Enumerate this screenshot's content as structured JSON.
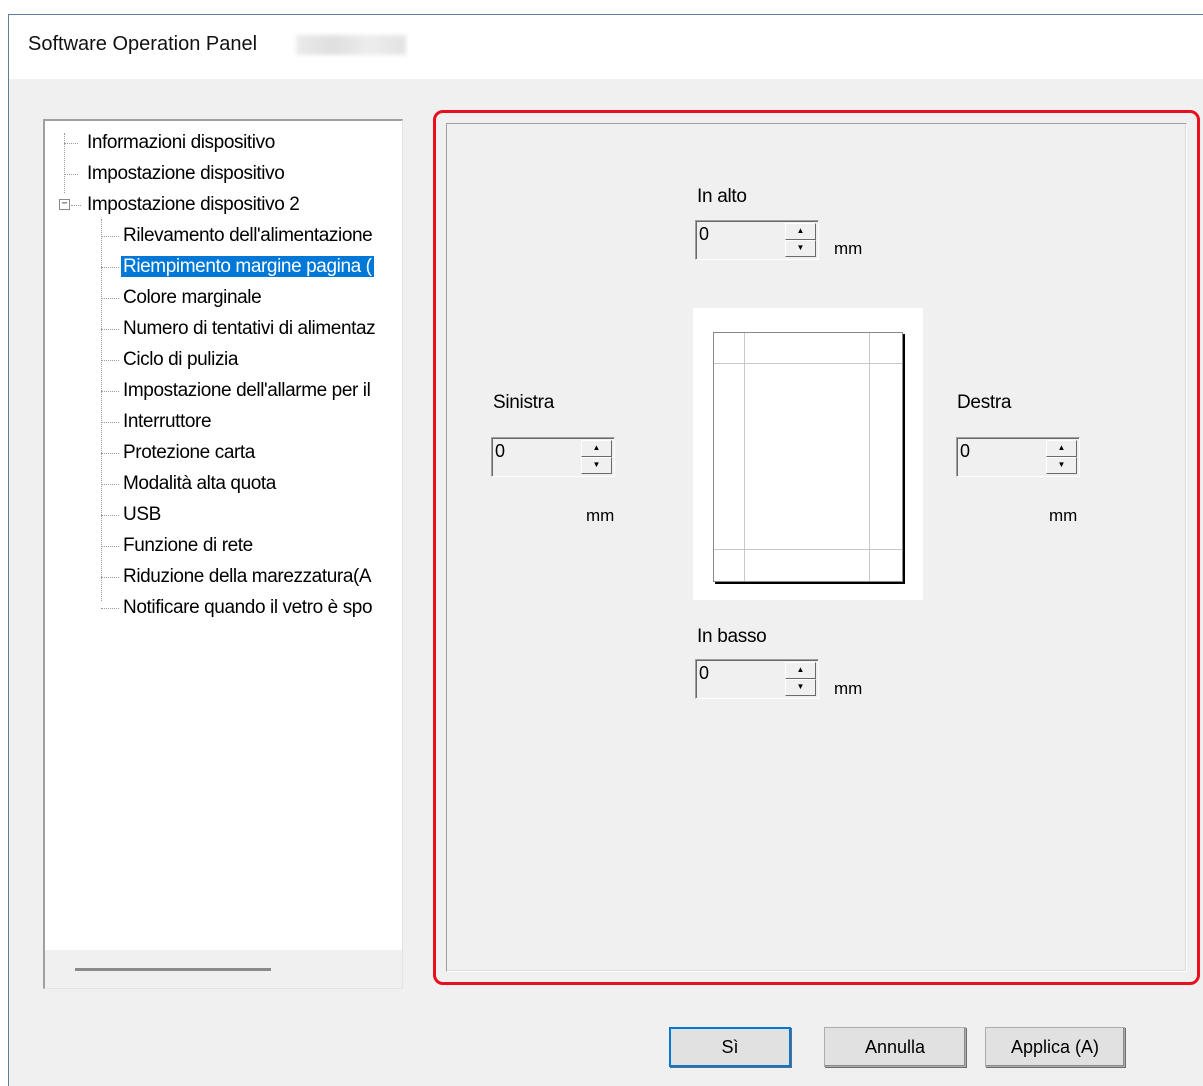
{
  "window": {
    "title": "Software Operation Panel"
  },
  "tree": {
    "items": [
      {
        "label": "Informazioni dispositivo"
      },
      {
        "label": "Impostazione dispositivo"
      },
      {
        "label": "Impostazione dispositivo 2",
        "expanded": true
      },
      {
        "label": "Rilevamento dell'alimentazione"
      },
      {
        "label": "Riempimento margine pagina (",
        "selected": true
      },
      {
        "label": "Colore marginale"
      },
      {
        "label": "Numero di tentativi di alimentaz"
      },
      {
        "label": "Ciclo di pulizia"
      },
      {
        "label": "Impostazione dell'allarme per il"
      },
      {
        "label": "Interruttore"
      },
      {
        "label": "Protezione carta"
      },
      {
        "label": "Modalità alta quota"
      },
      {
        "label": "USB"
      },
      {
        "label": "Funzione di rete"
      },
      {
        "label": "Riduzione della marezzatura(A"
      },
      {
        "label": "Notificare quando il vetro è spo"
      }
    ]
  },
  "margins": {
    "top": {
      "label": "In alto",
      "value": "0",
      "unit": "mm"
    },
    "left": {
      "label": "Sinistra",
      "value": "0",
      "unit": "mm"
    },
    "right": {
      "label": "Destra",
      "value": "0",
      "unit": "mm"
    },
    "bottom": {
      "label": "In basso",
      "value": "0",
      "unit": "mm"
    }
  },
  "buttons": {
    "ok": "Sì",
    "cancel": "Annulla",
    "apply": "Applica (A)"
  },
  "colors": {
    "highlight": "#e8101e",
    "selection": "#0078d7"
  }
}
